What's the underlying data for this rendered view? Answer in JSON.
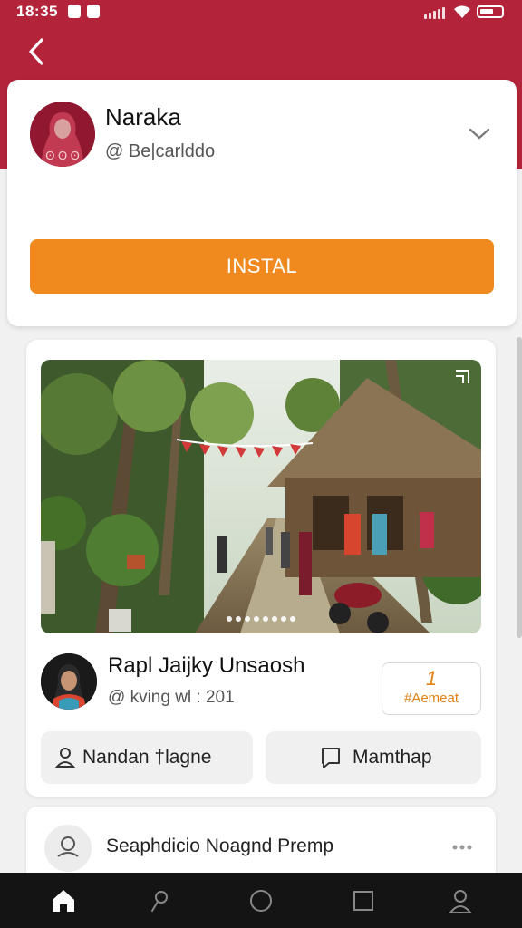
{
  "status_bar": {
    "time": "18:35",
    "icons": [
      "notification-icon",
      "app-icon",
      "signal-icon",
      "wifi-icon",
      "battery-icon"
    ]
  },
  "colors": {
    "header": "#b3243a",
    "accent": "#f08a1e",
    "badge": "#e28012",
    "nav_bar": "#141414"
  },
  "header": {
    "back_icon": "chevron-left-icon"
  },
  "profile": {
    "name": "Naraka",
    "handle": "@ Be|carlddo",
    "install_label": "INSTAL"
  },
  "post": {
    "image_alt": "village street with thatched houses, palms and motorbikes",
    "author_name": "Rapl Jaijky Unsaosh",
    "author_meta": "@ kving wl : 201",
    "badge_number": "1",
    "badge_label": "#Aemeat",
    "action_left_label": "Nandan †lagne",
    "action_right_label": "Mamthap"
  },
  "preview": {
    "title": "Seaphdicio Noagnd Premp"
  },
  "bottom_nav": {
    "items": [
      "home-icon",
      "search-icon",
      "circle-icon",
      "square-icon",
      "profile-icon"
    ]
  }
}
